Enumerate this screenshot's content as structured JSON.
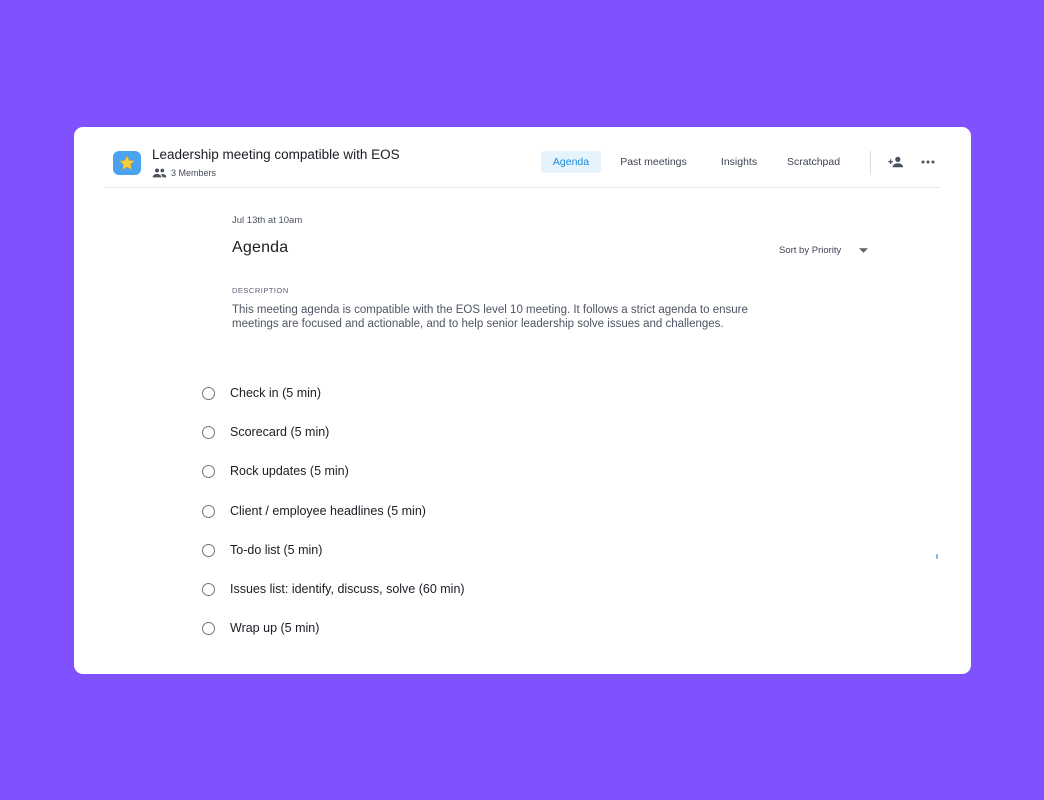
{
  "app": {
    "title": "Leadership meeting compatible with EOS",
    "members": "3 Members",
    "icon": "star-icon",
    "accent": "#1d8ad9",
    "background": "#8052FF"
  },
  "tabs": [
    {
      "label": "Agenda",
      "active": true
    },
    {
      "label": "Past meetings",
      "active": false
    },
    {
      "label": "Insights",
      "active": false
    },
    {
      "label": "Scratchpad",
      "active": false
    }
  ],
  "header_icons": [
    "add-person-icon",
    "more-icon"
  ],
  "meeting": {
    "date": "Jul 13th at 10am",
    "title": "Agenda",
    "sort_label": "Sort by Priority",
    "description_label": "DESCRIPTION",
    "description": "This meeting agenda is compatible with the EOS level 10 meeting. It follows a strict agenda to ensure meetings are focused and actionable, and to help senior leadership solve issues and challenges."
  },
  "agenda_items": [
    {
      "label": "Check in (5 min)",
      "checked": false
    },
    {
      "label": "Scorecard (5 min)",
      "checked": false
    },
    {
      "label": "Rock updates (5 min)",
      "checked": false
    },
    {
      "label": "Client / employee headlines (5 min)",
      "checked": false
    },
    {
      "label": "To-do list (5 min)",
      "checked": false
    },
    {
      "label": "Issues list: identify, discuss, solve (60 min)",
      "checked": false
    },
    {
      "label": "Wrap up (5 min)",
      "checked": false
    }
  ]
}
